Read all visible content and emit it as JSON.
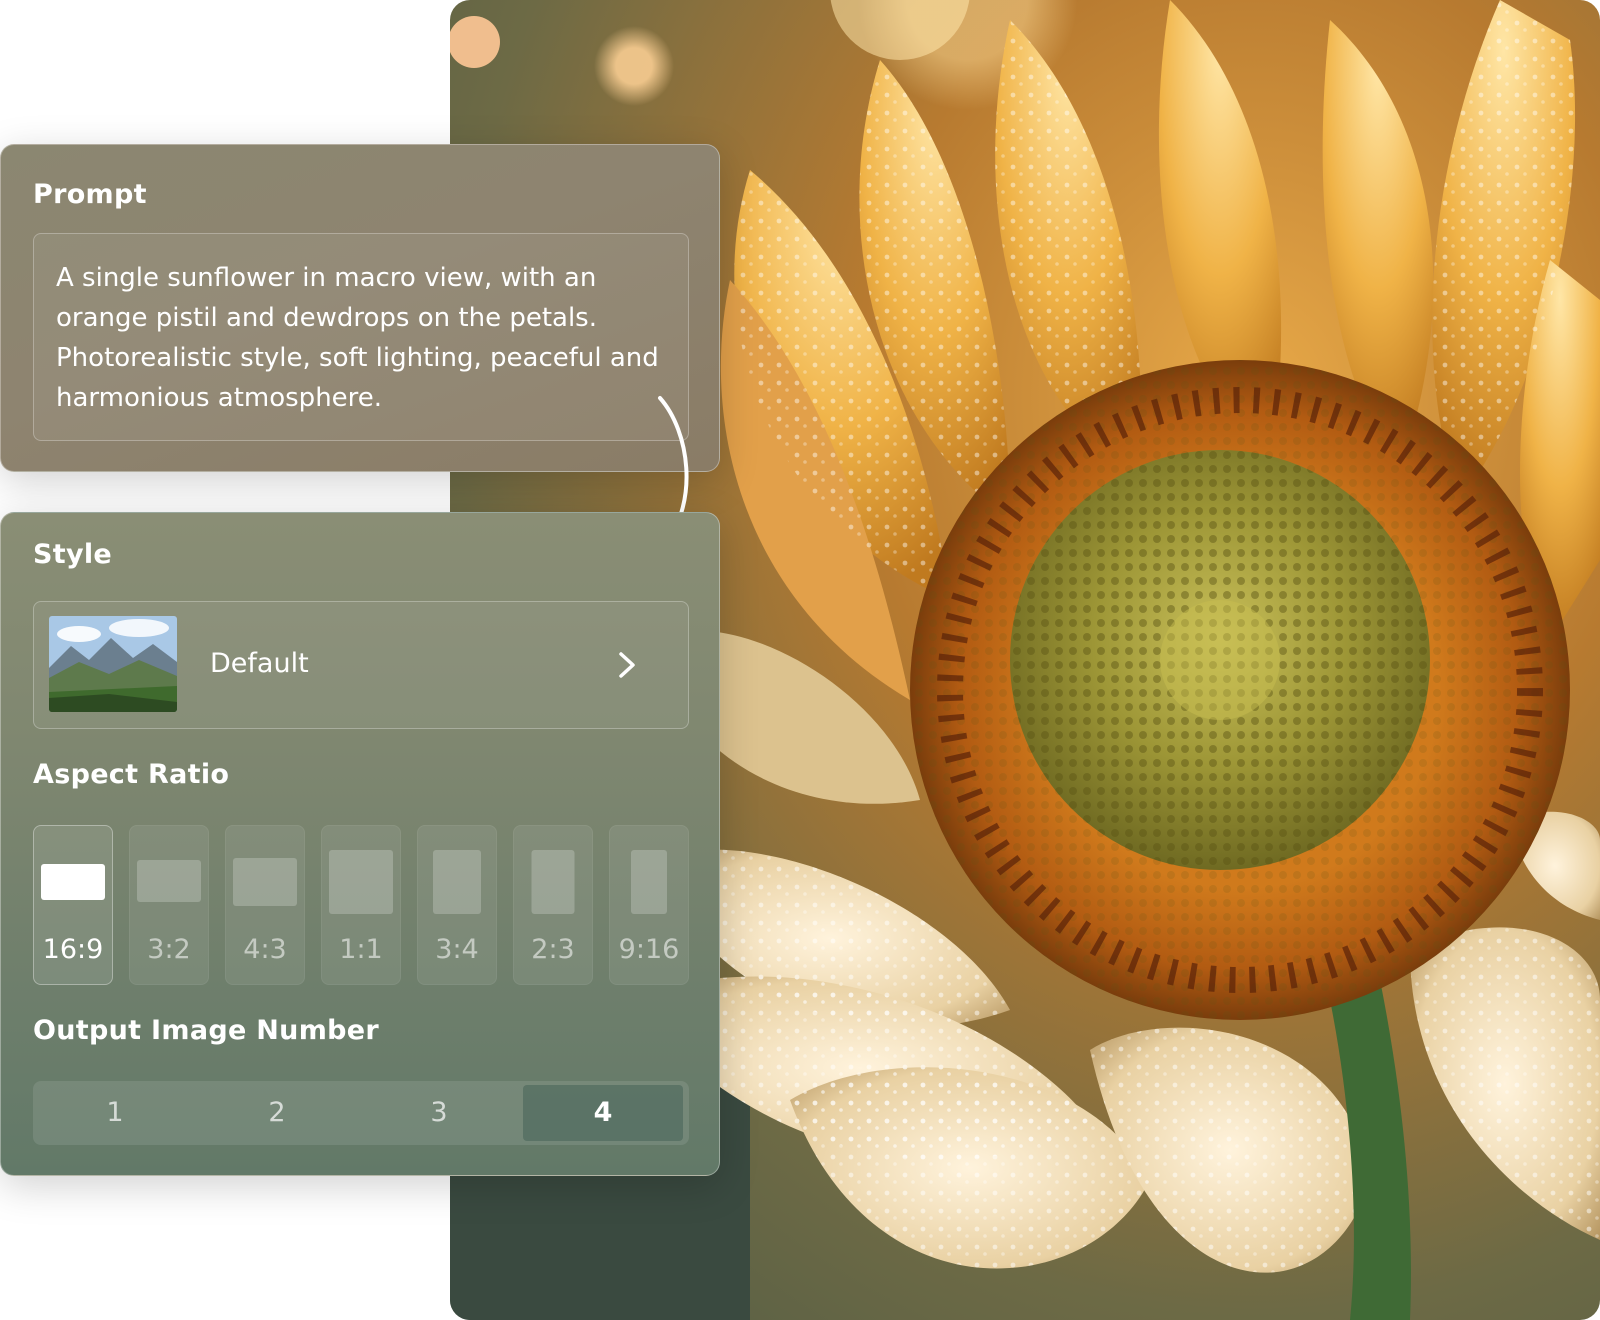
{
  "prompt_panel": {
    "title": "Prompt",
    "text": "A single sunflower in macro view, with an orange pistil and dewdrops on the petals. Photorealistic style, soft lighting, peaceful and harmonious atmosphere."
  },
  "settings_panel": {
    "style": {
      "title": "Style",
      "selected": "Default",
      "thumbnail_icon": "mountain-landscape-thumbnail",
      "arrow_icon": "chevron-right-icon"
    },
    "aspect_ratio": {
      "title": "Aspect Ratio",
      "options": [
        "16:9",
        "3:2",
        "4:3",
        "1:1",
        "3:4",
        "2:3",
        "9:16"
      ],
      "selected": "16:9"
    },
    "output_number": {
      "title": "Output Image Number",
      "options": [
        "1",
        "2",
        "3",
        "4"
      ],
      "selected": "4"
    }
  },
  "colors": {
    "petal": "#f1b64a",
    "center": "#a9a043",
    "ring": "#c8731f",
    "panel_text": "#ffffff"
  }
}
